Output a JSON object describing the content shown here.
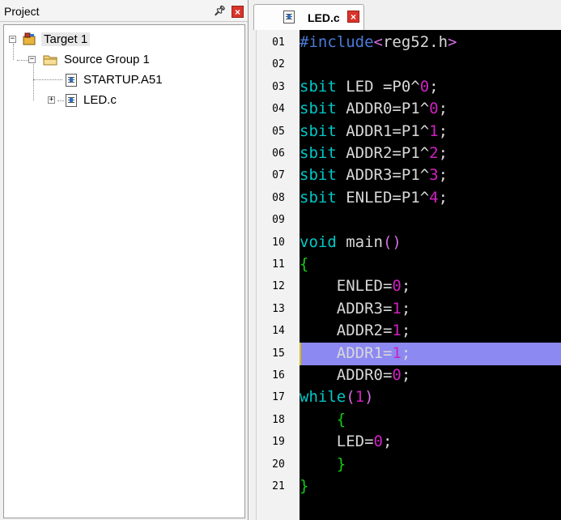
{
  "project_panel": {
    "title": "Project",
    "tree": {
      "target": "Target 1",
      "group": "Source Group 1",
      "files": [
        "STARTUP.A51",
        "LED.c"
      ]
    }
  },
  "editor": {
    "tab_label": "LED.c",
    "highlighted_line": 15,
    "line_numbers": [
      "01",
      "02",
      "03",
      "04",
      "05",
      "06",
      "07",
      "08",
      "09",
      "10",
      "11",
      "12",
      "13",
      "14",
      "15",
      "16",
      "17",
      "18",
      "19",
      "20",
      "21"
    ],
    "lines": [
      [
        [
          "pp",
          "#include"
        ],
        [
          "par",
          "<"
        ],
        [
          "txt",
          "reg52.h"
        ],
        [
          "par",
          ">"
        ]
      ],
      [],
      [
        [
          "kw",
          "sbit"
        ],
        [
          "txt",
          " LED =P0^"
        ],
        [
          "num",
          "0"
        ],
        [
          "txt",
          ";"
        ]
      ],
      [
        [
          "kw",
          "sbit"
        ],
        [
          "txt",
          " ADDR0=P1^"
        ],
        [
          "num",
          "0"
        ],
        [
          "txt",
          ";"
        ]
      ],
      [
        [
          "kw",
          "sbit"
        ],
        [
          "txt",
          " ADDR1=P1^"
        ],
        [
          "num",
          "1"
        ],
        [
          "txt",
          ";"
        ]
      ],
      [
        [
          "kw",
          "sbit"
        ],
        [
          "txt",
          " ADDR2=P1^"
        ],
        [
          "num",
          "2"
        ],
        [
          "txt",
          ";"
        ]
      ],
      [
        [
          "kw",
          "sbit"
        ],
        [
          "txt",
          " ADDR3=P1^"
        ],
        [
          "num",
          "3"
        ],
        [
          "txt",
          ";"
        ]
      ],
      [
        [
          "kw",
          "sbit"
        ],
        [
          "txt",
          " ENLED=P1^"
        ],
        [
          "num",
          "4"
        ],
        [
          "txt",
          ";"
        ]
      ],
      [],
      [
        [
          "kw",
          "void"
        ],
        [
          "txt",
          " main"
        ],
        [
          "par",
          "()"
        ]
      ],
      [
        [
          "brc",
          "{"
        ]
      ],
      [
        [
          "txt",
          "    ENLED="
        ],
        [
          "num",
          "0"
        ],
        [
          "txt",
          ";"
        ]
      ],
      [
        [
          "txt",
          "    ADDR3="
        ],
        [
          "num",
          "1"
        ],
        [
          "txt",
          ";"
        ]
      ],
      [
        [
          "txt",
          "    ADDR2="
        ],
        [
          "num",
          "1"
        ],
        [
          "txt",
          ";"
        ]
      ],
      [
        [
          "txt",
          "    ADDR1="
        ],
        [
          "num",
          "1"
        ],
        [
          "txt",
          ";"
        ]
      ],
      [
        [
          "txt",
          "    ADDR0="
        ],
        [
          "num",
          "0"
        ],
        [
          "txt",
          ";"
        ]
      ],
      [
        [
          "kw",
          "while"
        ],
        [
          "par",
          "("
        ],
        [
          "num",
          "1"
        ],
        [
          "par",
          ")"
        ]
      ],
      [
        [
          "brc",
          "    {"
        ]
      ],
      [
        [
          "txt",
          "    LED="
        ],
        [
          "num",
          "0"
        ],
        [
          "txt",
          ";"
        ]
      ],
      [
        [
          "brc",
          "    }"
        ]
      ],
      [
        [
          "brc",
          "}"
        ]
      ]
    ]
  },
  "colors": {
    "code_background": "#000000",
    "keyword": "#00c8c8",
    "number": "#d020c0",
    "brace": "#10d010",
    "highlight": "#8c89f2"
  },
  "icons": {
    "pin": "pin-icon",
    "close": "close-icon",
    "target": "target-icon",
    "folder": "folder-icon",
    "file": "file-icon"
  }
}
